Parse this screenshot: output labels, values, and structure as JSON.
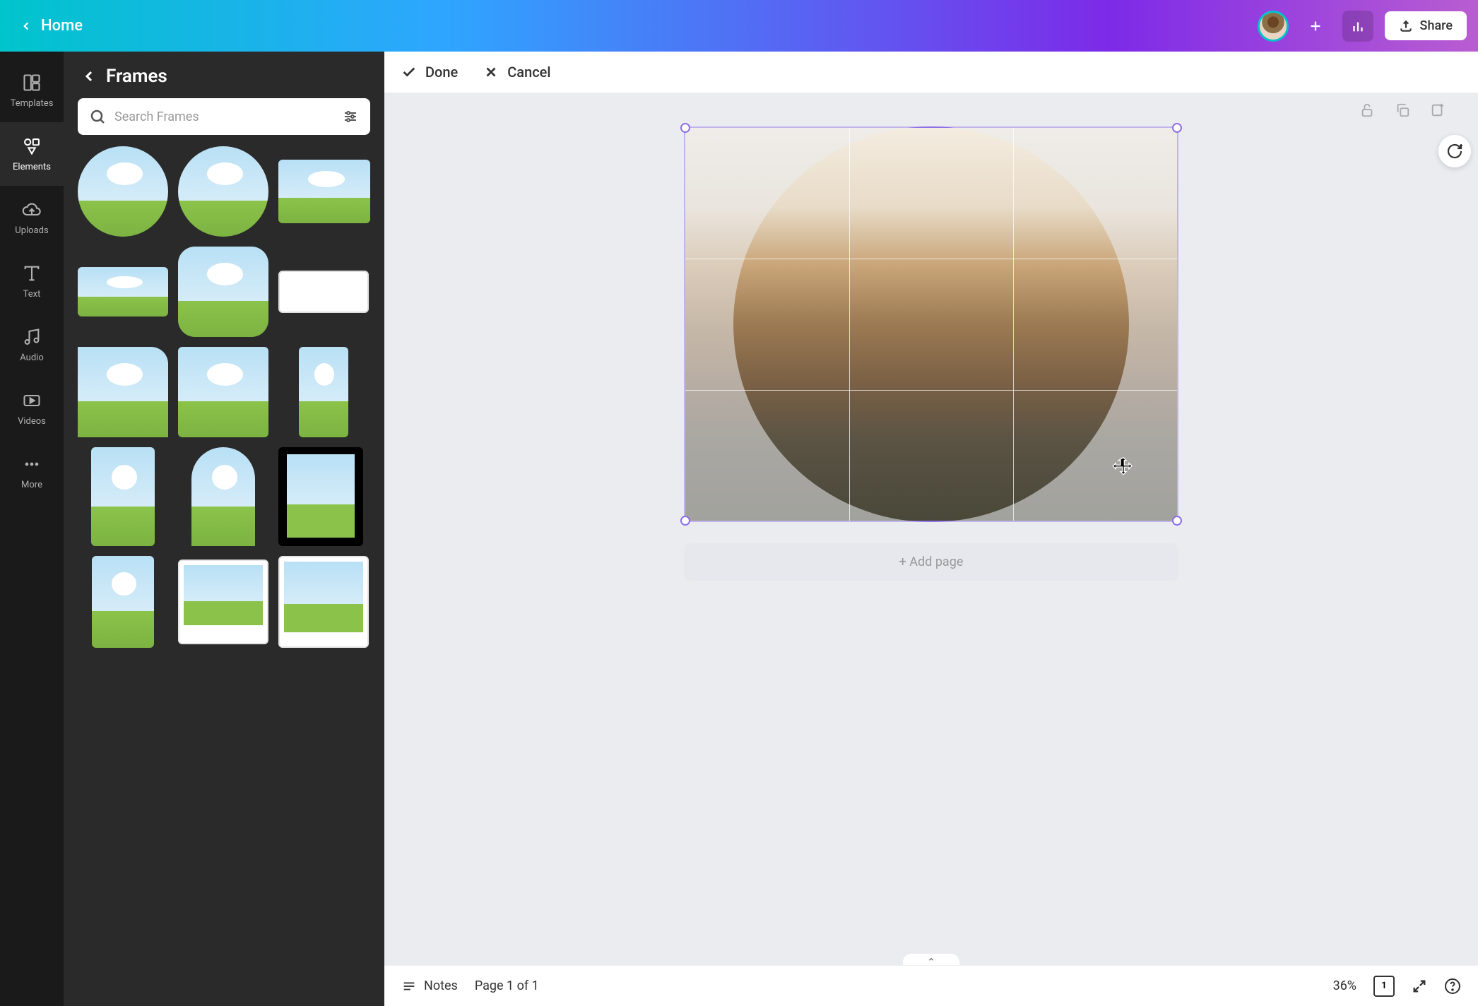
{
  "header": {
    "home_label": "Home",
    "share_label": "Share"
  },
  "left_rail": {
    "items": [
      {
        "label": "Templates"
      },
      {
        "label": "Elements"
      },
      {
        "label": "Uploads"
      },
      {
        "label": "Text"
      },
      {
        "label": "Audio"
      },
      {
        "label": "Videos"
      },
      {
        "label": "More"
      }
    ],
    "active_index": 1
  },
  "side_panel": {
    "title": "Frames",
    "search_placeholder": "Search Frames"
  },
  "edit_toolbar": {
    "done_label": "Done",
    "cancel_label": "Cancel"
  },
  "canvas": {
    "add_page_label": "+ Add page"
  },
  "bottom_bar": {
    "notes_label": "Notes",
    "page_indicator": "Page 1 of 1",
    "zoom_label": "36%",
    "page_count_badge": "1"
  }
}
